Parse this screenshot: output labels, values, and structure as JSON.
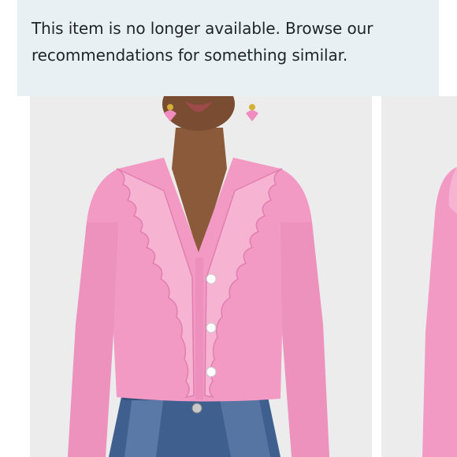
{
  "notice": {
    "message": "This item is no longer available. Browse our recommendations for something similar."
  },
  "gallery": {
    "images": [
      {
        "name": "product-photo-pink-ruffle-cardigan"
      },
      {
        "name": "product-photo-next-partial"
      }
    ]
  },
  "colors": {
    "notice_background": "#e9f0f3",
    "notice_text": "#1f2429",
    "photo_background": "#ededed",
    "cardigan_pink": "#f29ac4",
    "denim_blue": "#3f5f8f"
  }
}
